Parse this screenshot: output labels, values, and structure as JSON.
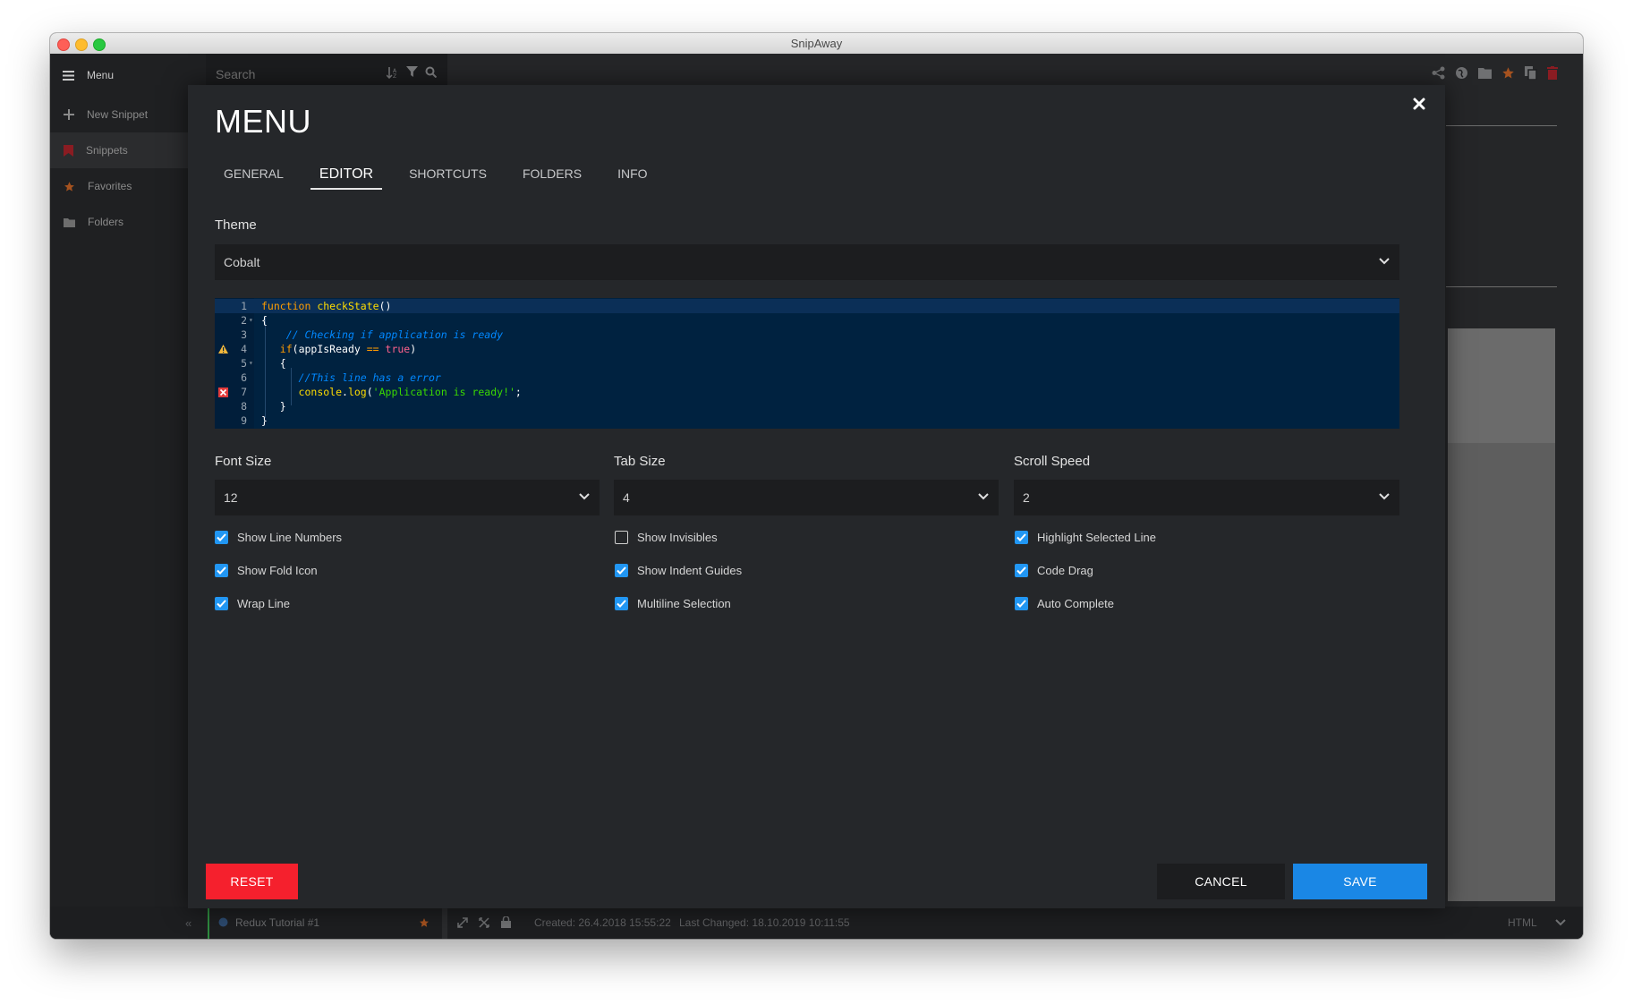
{
  "window": {
    "title": "SnipAway"
  },
  "sidebar": {
    "menu_label": "Menu",
    "items": [
      {
        "label": "New Snippet",
        "icon": "plus-icon"
      },
      {
        "label": "Snippets",
        "icon": "bookmark-icon"
      },
      {
        "label": "Favorites",
        "icon": "star-icon"
      },
      {
        "label": "Folders",
        "icon": "folder-icon"
      }
    ]
  },
  "search": {
    "placeholder": "Search"
  },
  "statusbar": {
    "snippet_name": "Redux Tutorial #1",
    "created": "Created: 26.4.2018 15:55:22",
    "last_changed": "Last Changed: 18.10.2019 10:11:55",
    "language": "HTML"
  },
  "modal": {
    "title": "MENU",
    "tabs": [
      {
        "label": "GENERAL",
        "active": false
      },
      {
        "label": "EDITOR",
        "active": true
      },
      {
        "label": "SHORTCUTS",
        "active": false
      },
      {
        "label": "FOLDERS",
        "active": false
      },
      {
        "label": "INFO",
        "active": false
      }
    ],
    "theme": {
      "label": "Theme",
      "value": "Cobalt"
    },
    "code_preview": {
      "line_numbers": [
        "1",
        "2",
        "3",
        "4",
        "5",
        "6",
        "7",
        "8",
        "9"
      ],
      "lines": [
        "function checkState()",
        "{",
        "    // Checking if application is ready",
        "    if(appIsReady == true)",
        "    {",
        "        //This line has a error",
        "        console.log('Application is ready!';",
        "    }",
        "}"
      ],
      "warning_line": "4",
      "error_line": "7"
    },
    "font_size": {
      "label": "Font Size",
      "value": "12"
    },
    "tab_size": {
      "label": "Tab Size",
      "value": "4"
    },
    "scroll_speed": {
      "label": "Scroll Speed",
      "value": "2"
    },
    "options": {
      "col1": [
        {
          "label": "Show Line Numbers",
          "checked": true
        },
        {
          "label": "Show Fold Icon",
          "checked": true
        },
        {
          "label": "Wrap Line",
          "checked": true
        }
      ],
      "col2": [
        {
          "label": "Show Invisibles",
          "checked": false
        },
        {
          "label": "Show Indent Guides",
          "checked": true
        },
        {
          "label": "Multiline Selection",
          "checked": true
        }
      ],
      "col3": [
        {
          "label": "Highlight Selected Line",
          "checked": true
        },
        {
          "label": "Code Drag",
          "checked": true
        },
        {
          "label": "Auto Complete",
          "checked": true
        }
      ]
    },
    "buttons": {
      "reset": "RESET",
      "cancel": "CANCEL",
      "save": "SAVE"
    }
  },
  "colors": {
    "accent_blue": "#2196f3",
    "reset_red": "#f5202d",
    "code_bg": "#002240"
  }
}
